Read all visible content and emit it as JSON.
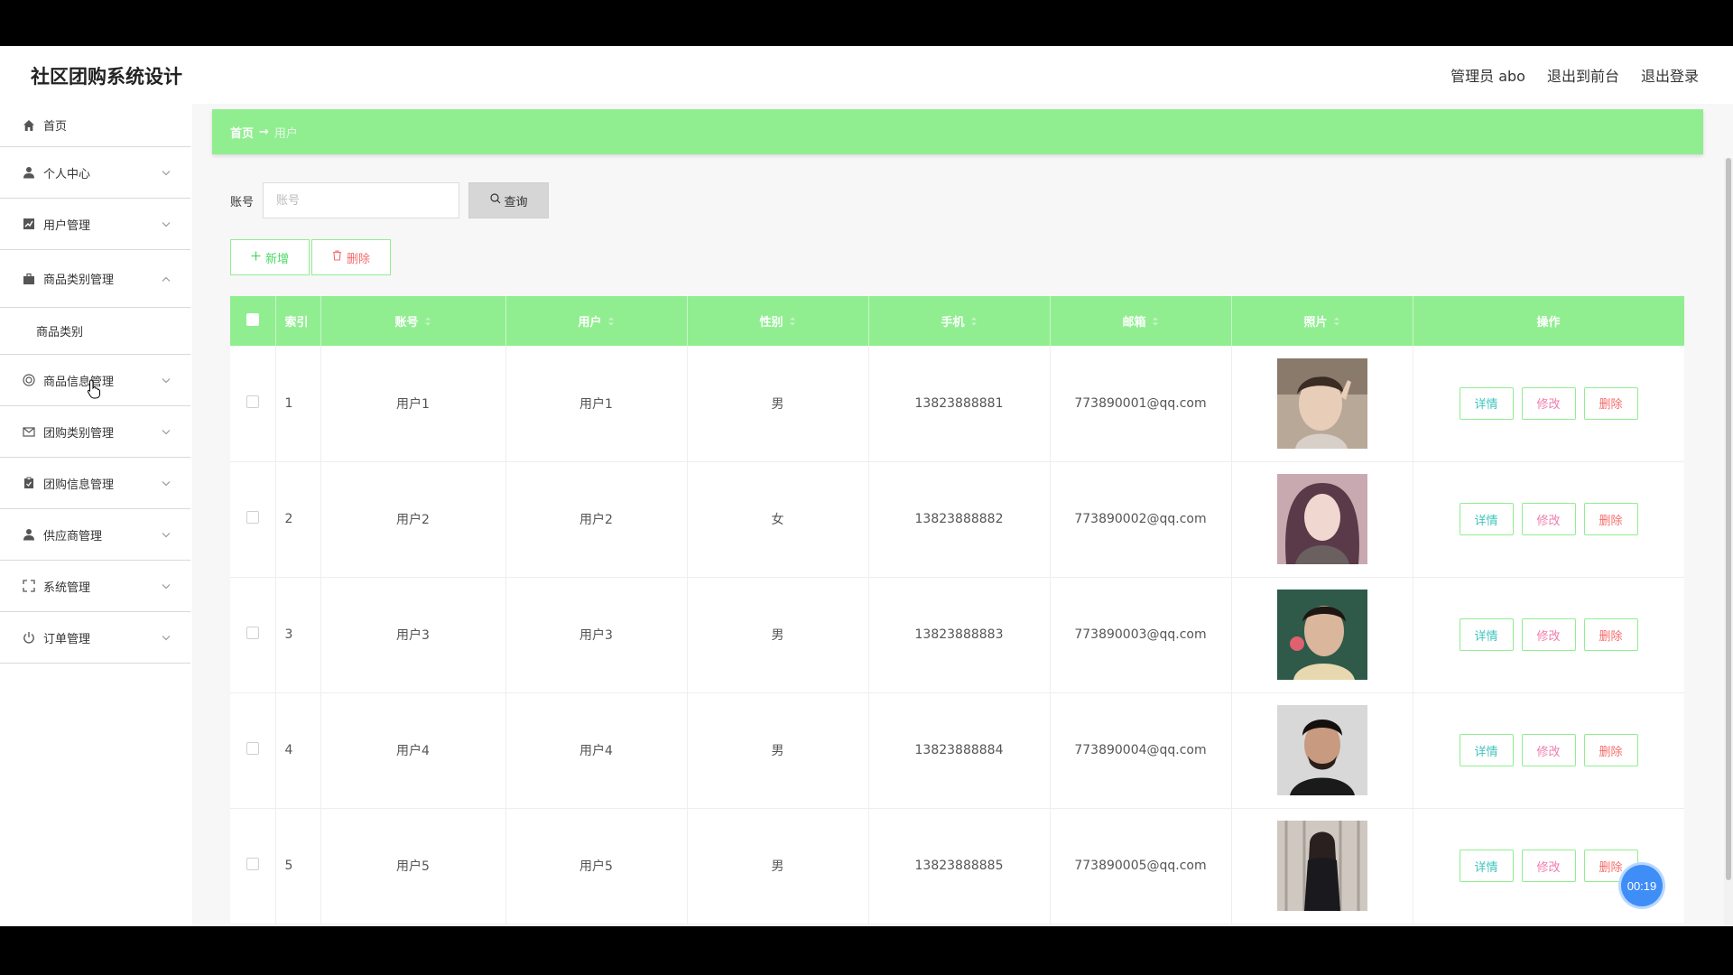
{
  "header": {
    "title": "社区团购系统设计",
    "admin_label": "管理员 abo",
    "to_front": "退出到前台",
    "logout": "退出登录"
  },
  "sidebar": {
    "items": [
      {
        "label": "首页",
        "icon": "home-icon"
      },
      {
        "label": "个人中心",
        "icon": "user-icon"
      },
      {
        "label": "用户管理",
        "icon": "chart-icon"
      },
      {
        "label": "商品类别管理",
        "icon": "briefcase-icon",
        "expanded": true
      },
      {
        "label": "商品信息管理",
        "icon": "target-icon"
      },
      {
        "label": "团购类别管理",
        "icon": "mail-icon"
      },
      {
        "label": "团购信息管理",
        "icon": "clipboard-icon"
      },
      {
        "label": "供应商管理",
        "icon": "person-icon"
      },
      {
        "label": "系统管理",
        "icon": "expand-icon"
      },
      {
        "label": "订单管理",
        "icon": "power-icon"
      }
    ],
    "submenu": {
      "label": "商品类别"
    }
  },
  "breadcrumb": {
    "home": "首页",
    "arrow": "→",
    "current": "用户"
  },
  "search": {
    "label": "账号",
    "placeholder": "账号",
    "button": "查询"
  },
  "actions": {
    "add": "新增",
    "delete": "删除"
  },
  "table": {
    "headers": [
      "索引",
      "账号",
      "用户",
      "性别",
      "手机",
      "邮箱",
      "照片",
      "操作"
    ],
    "rows": [
      {
        "index": "1",
        "account": "用户1",
        "user": "用户1",
        "gender": "男",
        "phone": "13823888881",
        "email": "773890001@qq.com"
      },
      {
        "index": "2",
        "account": "用户2",
        "user": "用户2",
        "gender": "女",
        "phone": "13823888882",
        "email": "773890002@qq.com"
      },
      {
        "index": "3",
        "account": "用户3",
        "user": "用户3",
        "gender": "男",
        "phone": "13823888883",
        "email": "773890003@qq.com"
      },
      {
        "index": "4",
        "account": "用户4",
        "user": "用户4",
        "gender": "男",
        "phone": "13823888884",
        "email": "773890004@qq.com"
      },
      {
        "index": "5",
        "account": "用户5",
        "user": "用户5",
        "gender": "男",
        "phone": "13823888885",
        "email": "773890005@qq.com"
      }
    ],
    "row_actions": {
      "detail": "详情",
      "edit": "修改",
      "delete": "删除"
    }
  },
  "timer": "00:19",
  "colors": {
    "accent_green": "#90ee90",
    "detail_text": "#3ec5bd",
    "edit_text": "#f07dae",
    "delete_text": "#f56c6c"
  }
}
